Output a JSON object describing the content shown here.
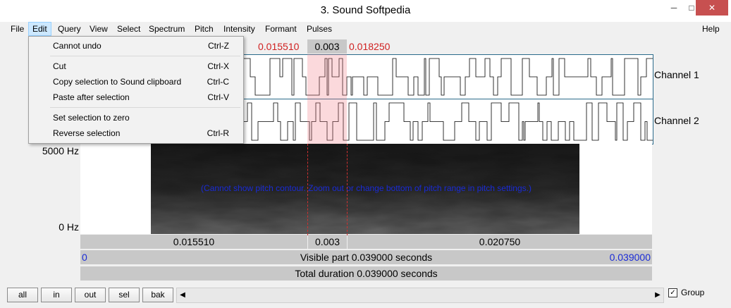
{
  "window": {
    "title": "3. Sound Softpedia",
    "minimize": "─",
    "maximize": "□",
    "close": "✕"
  },
  "menubar": {
    "items": [
      "File",
      "Edit",
      "Query",
      "View",
      "Select",
      "Spectrum",
      "Pitch",
      "Intensity",
      "Formant",
      "Pulses"
    ],
    "help": "Help",
    "active": "Edit"
  },
  "edit_menu": {
    "items": [
      {
        "label": "Cannot undo",
        "shortcut": "Ctrl-Z"
      },
      {
        "label": "Cut",
        "shortcut": "Ctrl-X"
      },
      {
        "label": "Copy selection to Sound clipboard",
        "shortcut": "Ctrl-C"
      },
      {
        "label": "Paste after selection",
        "shortcut": "Ctrl-V"
      },
      {
        "label": "Set selection to zero",
        "shortcut": ""
      },
      {
        "label": "Reverse selection",
        "shortcut": "Ctrl-R"
      }
    ]
  },
  "selection": {
    "start": "0.015510",
    "duration": "0.003",
    "end": "0.018250"
  },
  "channels": [
    "Channel 1",
    "Channel 2"
  ],
  "spectrogram": {
    "top_label": "5000 Hz",
    "bottom_label": "0 Hz",
    "message": "(Cannot show pitch contour. Zoom out or change bottom of pitch range in pitch settings.)"
  },
  "time_row": {
    "left": "0.015510",
    "mid": "0.003",
    "right": "0.020750"
  },
  "visible": {
    "start": "0",
    "label": "Visible part 0.039000 seconds",
    "end": "0.039000"
  },
  "total": {
    "label": "Total duration 0.039000 seconds"
  },
  "bottom_buttons": [
    "all",
    "in",
    "out",
    "sel",
    "bak"
  ],
  "group": {
    "label": "Group",
    "checked": true
  },
  "colors": {
    "selection": "#f08090",
    "blue_text": "#1a2bd6",
    "red_text": "#d02020"
  }
}
